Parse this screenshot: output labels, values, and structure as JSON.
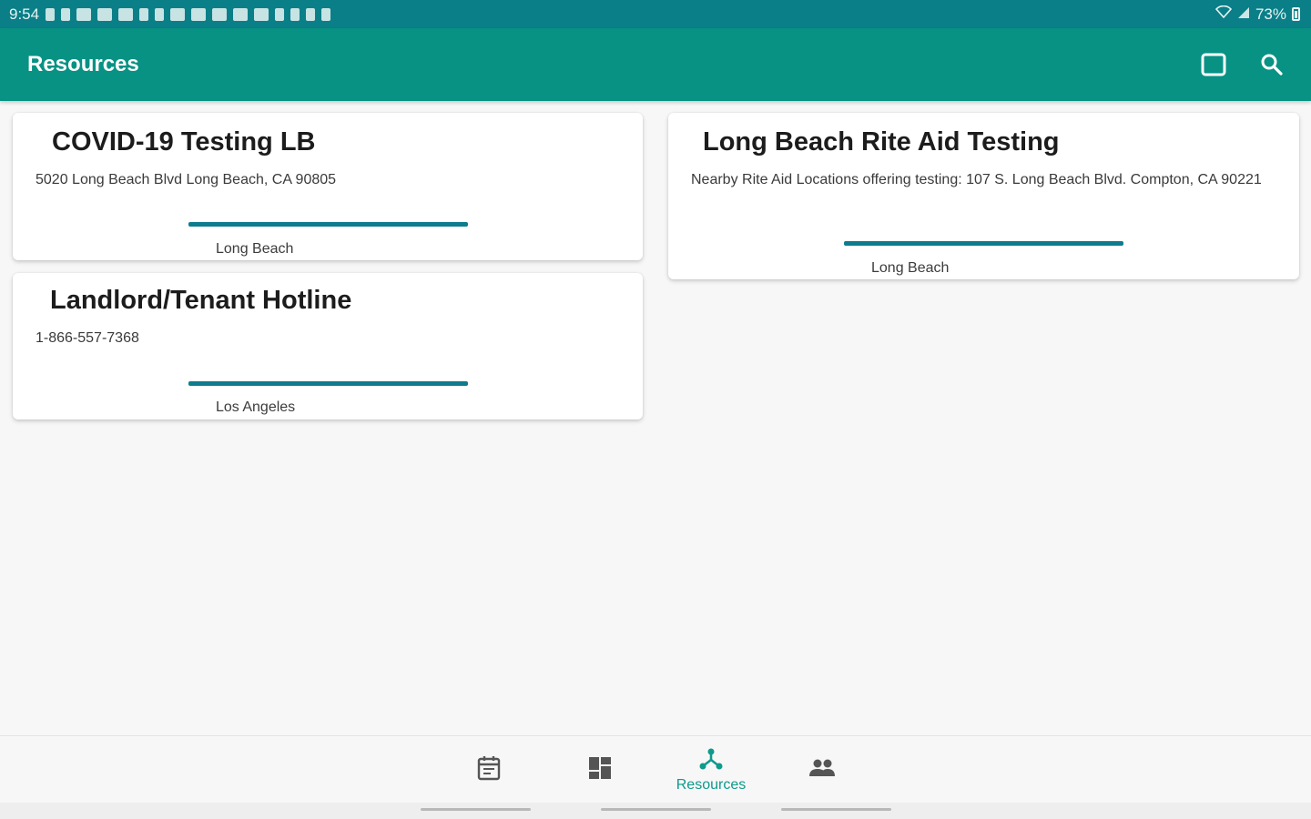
{
  "status_bar": {
    "time": "9:54",
    "battery": "73%"
  },
  "app_bar": {
    "title": "Resources",
    "actions": [
      {
        "name": "square-icon"
      },
      {
        "name": "search-icon"
      }
    ]
  },
  "resources": [
    {
      "title": "COVID-19 Testing LB",
      "description": "5020 Long Beach Blvd Long Beach, CA 90805",
      "location": "Long Beach"
    },
    {
      "title": "Long Beach Rite Aid Testing",
      "description": "Nearby Rite Aid Locations offering testing: 107 S. Long Beach Blvd. Compton, CA 90221",
      "location": "Long Beach"
    },
    {
      "title": "Landlord/Tenant Hotline",
      "description": "1-866-557-7368",
      "location": "Los Angeles"
    }
  ],
  "bottom_nav": {
    "items": [
      {
        "icon": "calendar-icon",
        "label": ""
      },
      {
        "icon": "dashboard-icon",
        "label": ""
      },
      {
        "icon": "hub-icon",
        "label": "Resources",
        "active": true
      },
      {
        "icon": "people-icon",
        "label": ""
      }
    ]
  },
  "colors": {
    "status_bar": "#0b7f88",
    "app_bar": "#079284",
    "accent": "#0e9a8c",
    "card_bar": "#0e7c8e"
  }
}
